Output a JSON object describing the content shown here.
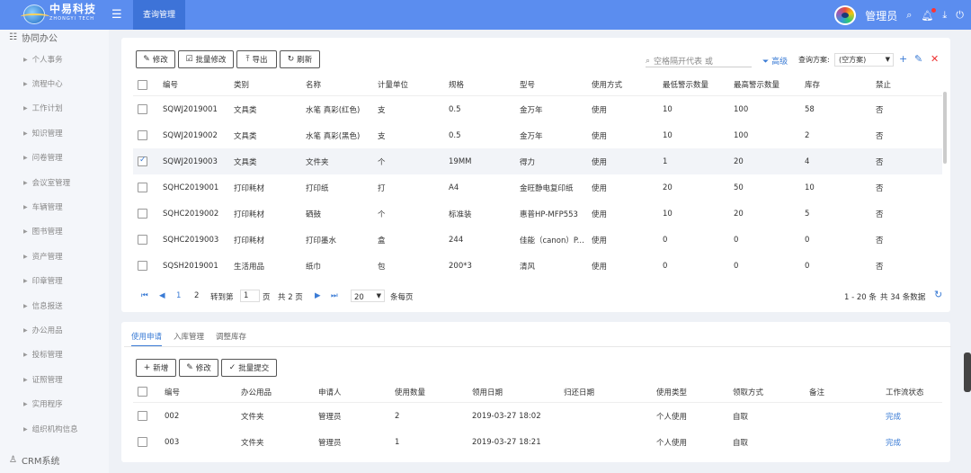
{
  "header": {
    "logo_cn": "中易科技",
    "logo_en": "ZHONGYI TECH",
    "active_tab": "查询管理",
    "username": "管理员"
  },
  "sidebar": {
    "group_title": "协同办公",
    "items": [
      "个人事务",
      "流程中心",
      "工作计划",
      "知识管理",
      "问卷管理",
      "会议室管理",
      "车辆管理",
      "图书管理",
      "资产管理",
      "印章管理",
      "信息报送",
      "办公用品",
      "投标管理",
      "证照管理",
      "实用程序",
      "组织机构信息"
    ],
    "crm_label": "CRM系统"
  },
  "toolbar": {
    "edit": "修改",
    "batch_edit": "批量修改",
    "export": "导出",
    "refresh": "刷新"
  },
  "search": {
    "placeholder": "空格隔开代表 或"
  },
  "filter": {
    "advanced": "高级",
    "scheme_label": "查询方案:",
    "scheme_value": "(空方案)"
  },
  "table": {
    "headers": [
      "编号",
      "类别",
      "名称",
      "计量单位",
      "规格",
      "型号",
      "使用方式",
      "最低警示数量",
      "最高警示数量",
      "库存",
      "禁止"
    ],
    "rows": [
      {
        "checked": false,
        "cells": [
          "SQWJ2019001",
          "文具类",
          "水笔 真彩(红色)",
          "支",
          "0.5",
          "金万年",
          "使用",
          "10",
          "100",
          "58",
          "否"
        ]
      },
      {
        "checked": false,
        "cells": [
          "SQWJ2019002",
          "文具类",
          "水笔 真彩(黑色)",
          "支",
          "0.5",
          "金万年",
          "使用",
          "10",
          "100",
          "2",
          "否"
        ]
      },
      {
        "checked": true,
        "cells": [
          "SQWJ2019003",
          "文具类",
          "文件夹",
          "个",
          "19MM",
          "得力",
          "使用",
          "1",
          "20",
          "4",
          "否"
        ]
      },
      {
        "checked": false,
        "cells": [
          "SQHC2019001",
          "打印耗材",
          "打印纸",
          "打",
          "A4",
          "金旺静电复印纸",
          "使用",
          "20",
          "50",
          "10",
          "否"
        ]
      },
      {
        "checked": false,
        "cells": [
          "SQHC2019002",
          "打印耗材",
          "硒鼓",
          "个",
          "标准装",
          "惠普HP-MFP553",
          "使用",
          "10",
          "20",
          "5",
          "否"
        ]
      },
      {
        "checked": false,
        "cells": [
          "SQHC2019003",
          "打印耗材",
          "打印墨水",
          "盒",
          "244",
          "佳能（canon）P...",
          "使用",
          "0",
          "0",
          "0",
          "否"
        ]
      },
      {
        "checked": false,
        "cells": [
          "SQSH2019001",
          "生活用品",
          "纸巾",
          "包",
          "200*3",
          "清风",
          "使用",
          "0",
          "0",
          "0",
          "否"
        ]
      }
    ]
  },
  "pager": {
    "page1": "1",
    "page2": "2",
    "goto_label": "转到第",
    "goto_value": "1",
    "page_suffix": "页",
    "total_pages": "共 2 页",
    "page_size": "20",
    "per_page": "条每页",
    "range": "1 - 20 条",
    "total": "共 34 条数据"
  },
  "bottom": {
    "tabs": [
      "使用申请",
      "入库管理",
      "调整库存"
    ],
    "add": "新增",
    "edit": "修改",
    "batch_submit": "批量提交",
    "headers": [
      "编号",
      "办公用品",
      "申请人",
      "使用数量",
      "领用日期",
      "归还日期",
      "使用类型",
      "领取方式",
      "备注",
      "工作流状态"
    ],
    "rows": [
      {
        "cells": [
          "002",
          "文件夹",
          "管理员",
          "2",
          "2019-03-27 18:02",
          "",
          "个人使用",
          "自取",
          "",
          "完成"
        ]
      },
      {
        "cells": [
          "003",
          "文件夹",
          "管理员",
          "1",
          "2019-03-27 18:21",
          "",
          "个人使用",
          "自取",
          "",
          "完成"
        ]
      }
    ]
  },
  "colors": {
    "brand": "#5b8def",
    "accent": "#3a7bd5",
    "danger": "#e33"
  }
}
